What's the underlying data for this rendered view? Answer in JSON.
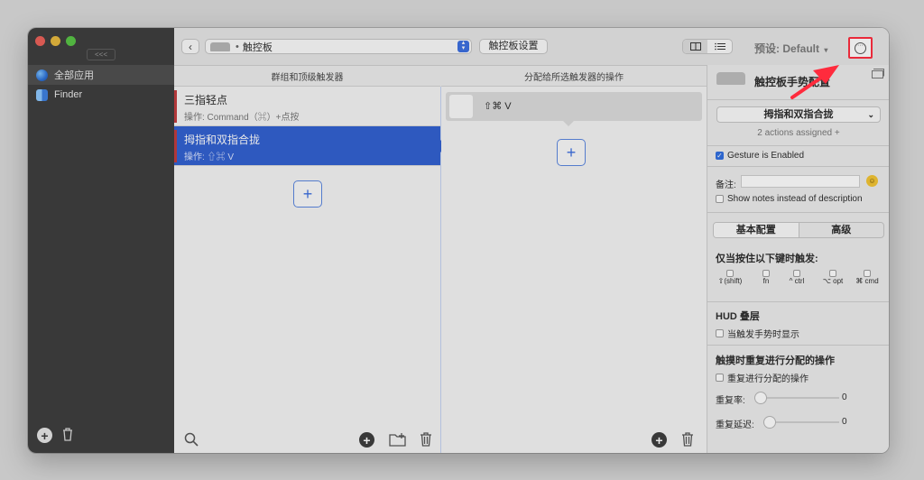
{
  "sidebar": {
    "collapse_label": "<<<",
    "apps": [
      {
        "label": "全部应用",
        "icon": "globe-icon"
      },
      {
        "label": "Finder",
        "icon": "finder-icon"
      }
    ]
  },
  "toolbar": {
    "device_label": "触控板",
    "settings_button": "触控板设置",
    "preset_label": "预设: Default"
  },
  "triggers": {
    "header": "群组和顶级触发器",
    "items": [
      {
        "name": "三指轻点",
        "action": "操作: Command（⌘）+点按",
        "selected": false
      },
      {
        "name": "拇指和双指合拢",
        "action": "操作: ⇧⌘ V",
        "selected": true
      }
    ]
  },
  "actions": {
    "header": "分配给所选触发器的操作",
    "items": [
      {
        "label": "⇧⌘ V"
      }
    ]
  },
  "inspector": {
    "title": "触控板手势配置",
    "gesture_select": "拇指和双指合拢",
    "assigned_text": "2 actions assigned +",
    "gesture_enabled": "Gesture is Enabled",
    "notes_label": "备注:",
    "show_notes": "Show notes instead of description",
    "tab_basic": "基本配置",
    "tab_advanced": "高级",
    "modifier_heading": "仅当按住以下键时触发:",
    "modifiers": [
      "⇧(shift)",
      "fn",
      "^ ctrl",
      "⌥ opt",
      "⌘ cmd"
    ],
    "hud_heading": "HUD 叠层",
    "hud_option": "当触发手势时显示",
    "repeat_heading": "触摸时重复进行分配的操作",
    "repeat_option": "重复进行分配的操作",
    "repeat_rate_label": "重复率:",
    "repeat_rate_value": "0",
    "repeat_delay_label": "重复延迟:",
    "repeat_delay_value": "0"
  },
  "colors": {
    "accent": "#2f5fd1",
    "highlight_red": "#ff2b3d"
  }
}
